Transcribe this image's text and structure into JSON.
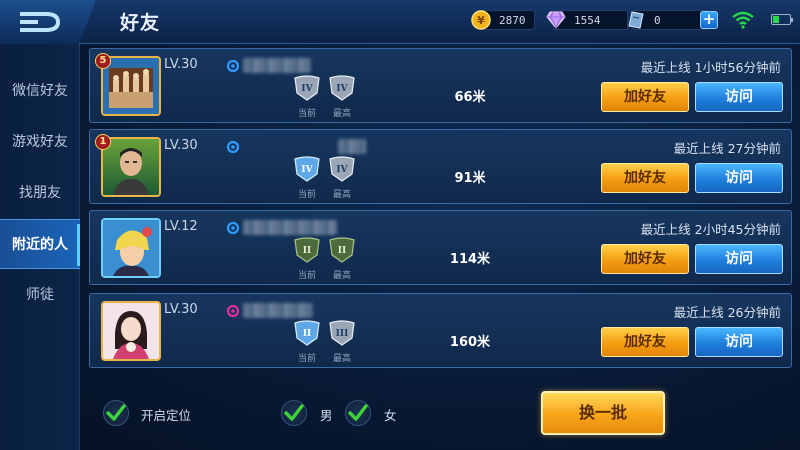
{
  "header": {
    "title": "好友"
  },
  "currencies": [
    {
      "icon": "gold-coin-icon",
      "value": "2870"
    },
    {
      "icon": "diamond-icon",
      "value": "1554"
    },
    {
      "icon": "voucher-icon",
      "value": "0"
    }
  ],
  "sidebar": {
    "items": [
      {
        "label": "微信好友",
        "active": false
      },
      {
        "label": "游戏好友",
        "active": false
      },
      {
        "label": "找朋友",
        "active": false
      },
      {
        "label": "附近的人",
        "active": true
      },
      {
        "label": "师徒",
        "active": false
      }
    ]
  },
  "friends": [
    {
      "badge": "5",
      "level": "LV.30",
      "gender": "male",
      "tier_current": "IV",
      "tier_highest": "IV",
      "tier_current_label": "当前",
      "tier_highest_label": "最高",
      "distance": "66米",
      "last_online": "最近上线  1小时56分钟前",
      "add_label": "加好友",
      "visit_label": "访问",
      "avatar": "chess-avatar"
    },
    {
      "badge": "1",
      "level": "LV.30",
      "gender": "male",
      "tier_current": "IV",
      "tier_highest": "IV",
      "tier_current_label": "当前",
      "tier_highest_label": "最高",
      "distance": "91米",
      "last_online": "最近上线  27分钟前",
      "add_label": "加好友",
      "visit_label": "访问",
      "avatar": "man-avatar"
    },
    {
      "badge": "",
      "level": "LV.12",
      "gender": "male",
      "tier_current": "II",
      "tier_highest": "II",
      "tier_current_label": "当前",
      "tier_highest_label": "最高",
      "distance": "114米",
      "last_online": "最近上线  2小时45分钟前",
      "add_label": "加好友",
      "visit_label": "访问",
      "avatar": "anime-avatar"
    },
    {
      "badge": "",
      "level": "LV.30",
      "gender": "female",
      "tier_current": "II",
      "tier_highest": "III",
      "tier_current_label": "当前",
      "tier_highest_label": "最高",
      "distance": "160米",
      "last_online": "最近上线  26分钟前",
      "add_label": "加好友",
      "visit_label": "访问",
      "avatar": "girl-avatar"
    }
  ],
  "filters": {
    "location_label": "开启定位",
    "male_label": "男",
    "female_label": "女"
  },
  "refresh_label": "换一批",
  "colors": {
    "accent_orange": "#f59d12",
    "accent_blue": "#1f7fdc",
    "check_green": "#3fd33a",
    "wifi_green": "#27d94a"
  }
}
